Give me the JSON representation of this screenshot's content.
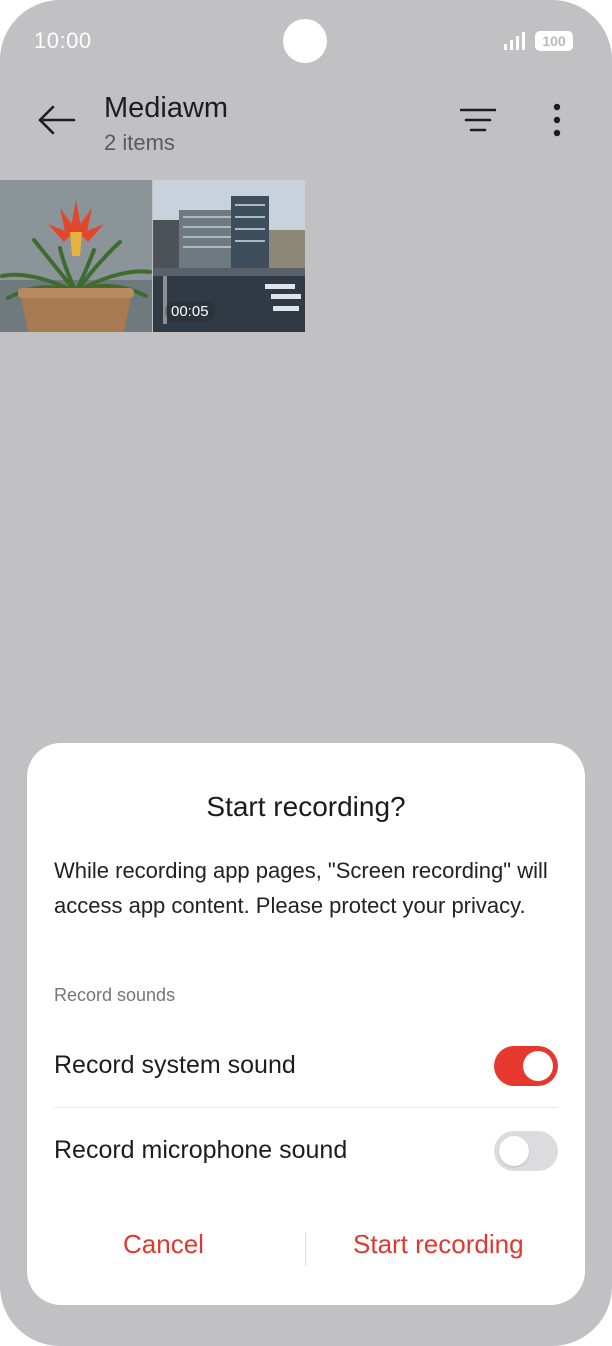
{
  "status_bar": {
    "time": "10:00",
    "battery": "100"
  },
  "app_bar": {
    "title": "Mediawm",
    "subtitle": "2 items"
  },
  "gallery": {
    "items": [
      {
        "type": "photo",
        "subject": "potted plant"
      },
      {
        "type": "video",
        "subject": "harbor buildings",
        "duration": "00:05"
      }
    ]
  },
  "dialog": {
    "title": "Start recording?",
    "body": "While recording app pages, \"Screen recording\" will access app content. Please protect your privacy.",
    "section_label": "Record sounds",
    "options": [
      {
        "label": "Record system sound",
        "enabled": true
      },
      {
        "label": "Record microphone sound",
        "enabled": false
      }
    ],
    "cancel_label": "Cancel",
    "confirm_label": "Start recording"
  },
  "colors": {
    "accent": "#e7382f",
    "scrim_background": "#c1c1c3",
    "dialog_background": "#ffffff"
  },
  "icons": [
    "back-arrow-icon",
    "filter-icon",
    "more-vertical-icon",
    "signal-icon"
  ]
}
